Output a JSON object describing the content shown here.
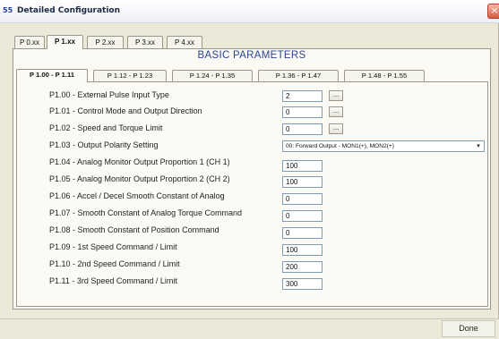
{
  "window": {
    "title": "Detailed Configuration",
    "app_icon": "55",
    "close": "×"
  },
  "outer_tabs": [
    "P 0.xx",
    "P 1.xx",
    "P 2.xx",
    "P 3.xx",
    "P 4.xx"
  ],
  "outer_active": "P 1.xx",
  "section_title": "BASIC PARAMETERS",
  "inner_tabs": [
    "P 1.00 - P 1.11",
    "P 1.12 - P 1.23",
    "P 1.24 - P 1.35",
    "P 1.36 - P 1.47",
    "P 1.48 - P 1.55"
  ],
  "inner_active": "P 1.00 - P 1.11",
  "params": [
    {
      "label": "P1.00 - External Pulse Input Type",
      "value": "2",
      "has_button": true
    },
    {
      "label": "P1.01 - Control Mode and Output Direction",
      "value": "0",
      "has_button": true
    },
    {
      "label": "P1.02 - Speed and Torque Limit",
      "value": "0",
      "has_button": true
    },
    {
      "label": "P1.03 - Output Polarity Setting",
      "value": "00: Forward Output - MON1(+), MON2(+)",
      "is_select": true
    },
    {
      "label": "P1.04 - Analog Monitor Output Proportion 1 (CH 1)",
      "value": "100"
    },
    {
      "label": "P1.05 - Analog Monitor Output Proportion 2 (CH 2)",
      "value": "100"
    },
    {
      "label": "P1.06 - Accel / Decel Smooth Constant of Analog",
      "value": "0"
    },
    {
      "label": "P1.07 - Smooth Constant of Analog Torque Command",
      "value": "0"
    },
    {
      "label": "P1.08 - Smooth Constant of Position Command",
      "value": "0"
    },
    {
      "label": "P1.09 - 1st Speed Command / Limit",
      "value": "100"
    },
    {
      "label": "P1.10 - 2nd Speed Command / Limit",
      "value": "200"
    },
    {
      "label": "P1.11 - 3rd Speed Command / Limit",
      "value": "300"
    }
  ],
  "ellipsis_label": "...",
  "select_arrow": "▾",
  "done_label": "Done"
}
